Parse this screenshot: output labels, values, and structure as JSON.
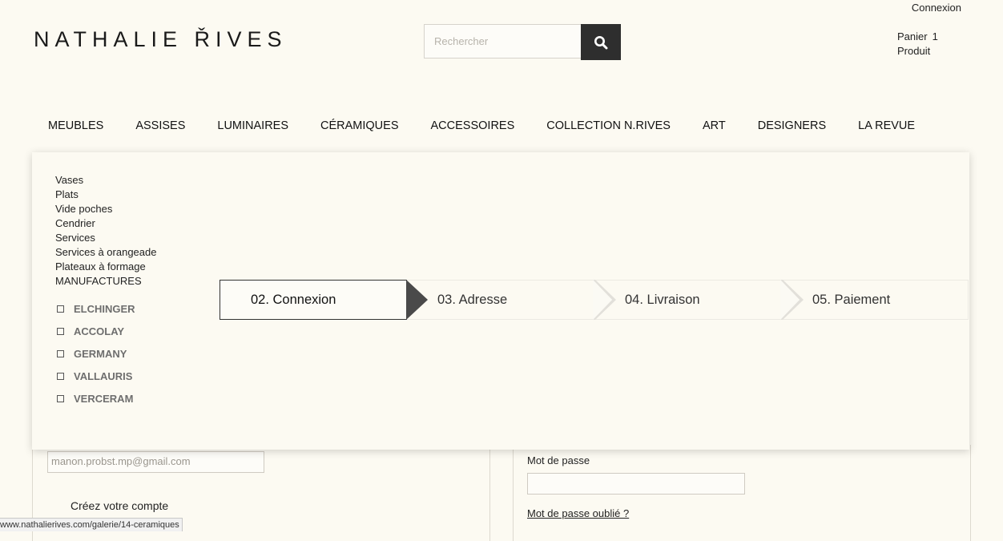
{
  "header": {
    "login_label": "Connexion",
    "logo_text": "NATHALIE ŘIVES",
    "search_placeholder": "Rechercher",
    "cart_label": "Panier",
    "cart_count": "1",
    "cart_unit": "Produit"
  },
  "nav": {
    "items": [
      "MEUBLES",
      "ASSISES",
      "LUMINAIRES",
      "CÉRAMIQUES",
      "ACCESSOIRES",
      "COLLECTION N.RIVES",
      "ART",
      "DESIGNERS",
      "LA REVUE"
    ]
  },
  "dropdown": {
    "categories": [
      "Vases",
      "Plats",
      "Vide poches",
      "Cendrier",
      "Services",
      "Services à orangeade",
      "Plateaux à formage",
      "MANUFACTURES"
    ],
    "manufacturers": [
      "ELCHINGER",
      "ACCOLAY",
      "GERMANY",
      "VALLAURIS",
      "VERCERAM"
    ]
  },
  "checkout_steps": {
    "items": [
      "02. Connexion",
      "03. Adresse",
      "04. Livraison",
      "05. Paiement"
    ],
    "active_index": 0
  },
  "login_form": {
    "email_value": "manon.probst.mp@gmail.com",
    "create_account_label": "Créez votre compte",
    "password_label": "Mot de passe",
    "forgot_password_label": "Mot de passe oublié ?"
  },
  "status_bar": {
    "url": "www.nathalierives.com/galerie/14-ceramiques"
  },
  "colors": {
    "background": "#fcfaf2",
    "search_button": "#2e2e2e",
    "step_arrow_active": "#4a4a4a",
    "manufacturer_text": "#6e6e6e"
  }
}
